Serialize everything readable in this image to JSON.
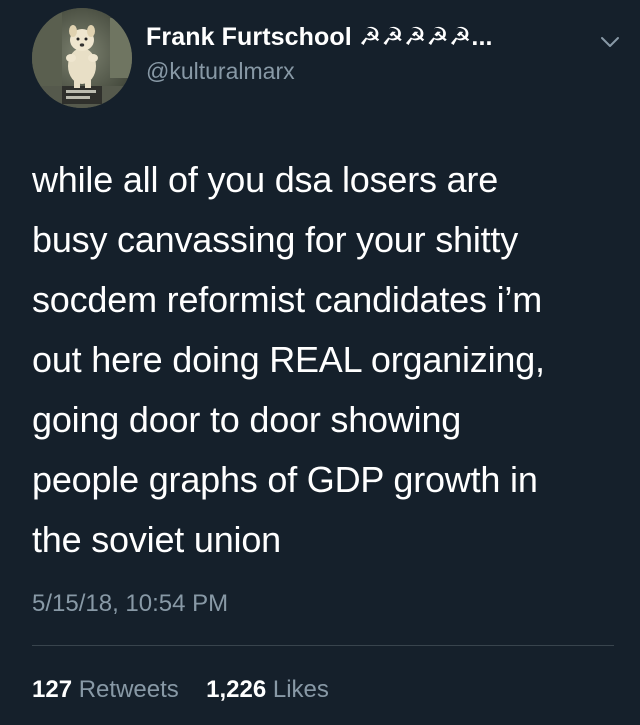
{
  "user": {
    "display_name": "Frank Furtschool ☭☭☭☭☭...",
    "handle": "@kulturalmarx"
  },
  "tweet": {
    "lines": [
      "while all of you dsa losers are",
      "busy canvassing for your shitty",
      "socdem reformist candidates i’m",
      "out here doing REAL organizing,",
      "going door to door showing",
      "people graphs of GDP growth in",
      "the soviet union"
    ],
    "timestamp": "5/15/18, 10:54 PM"
  },
  "stats": {
    "retweets_count": "127",
    "retweets_label": "Retweets",
    "likes_count": "1,226",
    "likes_label": "Likes"
  },
  "icons": {
    "caret": "chevron-down-icon",
    "avatar": "avatar-dog-photo"
  },
  "colors": {
    "background": "#15202b",
    "primary_text": "#ffffff",
    "secondary_text": "#8899a6",
    "divider": "#38444d"
  }
}
